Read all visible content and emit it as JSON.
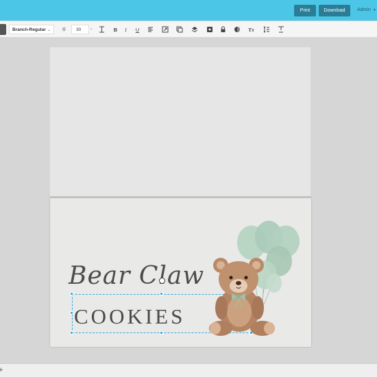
{
  "topbar": {
    "print_label": "Print",
    "download_label": "Download",
    "user_menu_label": "Admin"
  },
  "toolbar": {
    "font_family_value": "Branch-Regular",
    "font_size_value": "30",
    "icons": [
      "font-style-icon",
      "letter-spacing-icon",
      "bold-icon",
      "italic-icon",
      "underline-icon",
      "align-icon",
      "resize-icon",
      "copy-icon",
      "layers-icon",
      "lock-alt-icon",
      "lock-icon",
      "color-icon",
      "text-transform-icon",
      "line-height-icon",
      "text-case-icon"
    ]
  },
  "card": {
    "title_script": "Bear Claw",
    "title_caps": "COOKIES"
  },
  "bottombar": {
    "add_label": "+"
  },
  "colors": {
    "topbar": "#4bc6e6",
    "button": "#2b7d96",
    "selection": "#2fb0e8",
    "balloon": "#a9cdb8",
    "bear": "#b98a68"
  }
}
